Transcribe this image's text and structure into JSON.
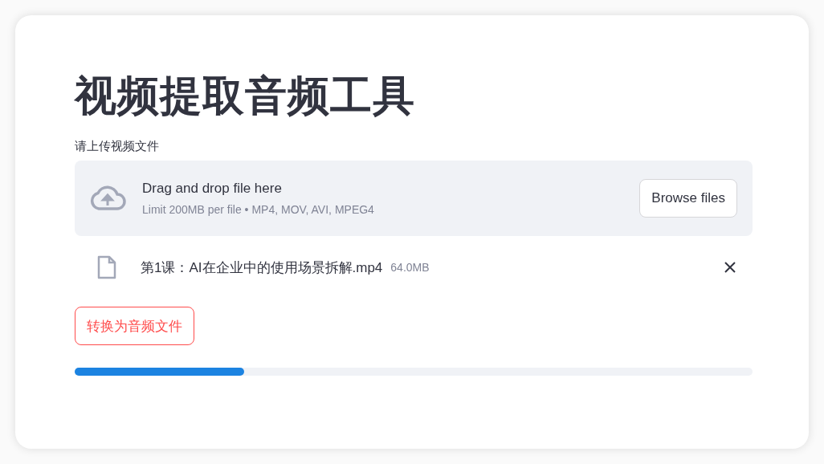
{
  "title": "视频提取音频工具",
  "uploader": {
    "label": "请上传视频文件",
    "dropzone_text": "Drag and drop file here",
    "limit_text": "Limit 200MB per file • MP4, MOV, AVI, MPEG4",
    "browse_button": "Browse files"
  },
  "files": [
    {
      "name": "第1课：AI在企业中的使用场景拆解.mp4",
      "size": "64.0MB"
    }
  ],
  "convert_button": "转换为音频文件",
  "progress": {
    "level": 0.25
  }
}
